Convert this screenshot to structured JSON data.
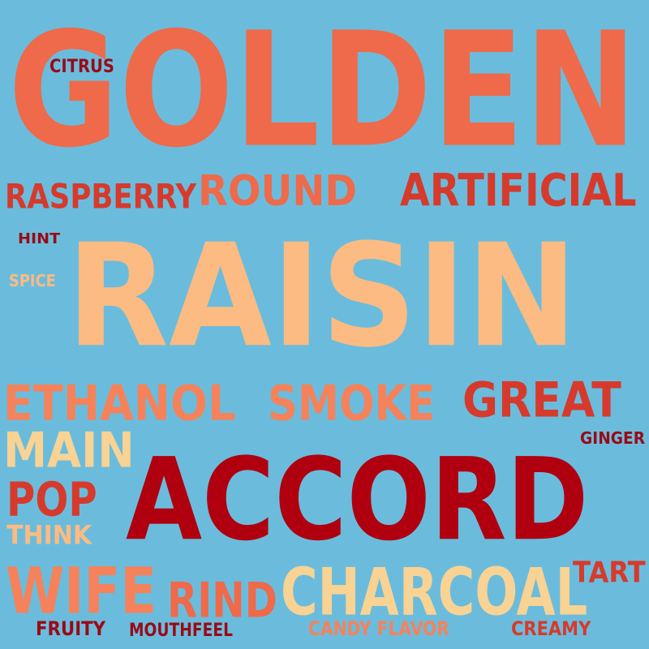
{
  "word_cloud": {
    "background": "#6bbcdc",
    "palette": {
      "salmon": "#ee6a4a",
      "peach": "#fcbb82",
      "red": "#d63a2c",
      "dark_red": "#b00010",
      "maroon": "#9a0a16",
      "light": "#f8d394",
      "orange": "#f5825a"
    },
    "words": {
      "golden": "GOLDEN",
      "citrus": "CITRUS",
      "raspberry": "RASPBERRY",
      "round": "ROUND",
      "artificial": "ARTIFICIAL",
      "hint": "HINT",
      "spice": "SPICE",
      "raisin": "RAISIN",
      "ethanol": "ETHANOL",
      "smoke": "SMOKE",
      "great": "GREAT",
      "main": "MAIN",
      "ginger": "GINGER",
      "pop": "POP",
      "accord": "ACCORD",
      "think": "THINK",
      "wife": "WIFE",
      "rind": "RIND",
      "charcoal": "CHARCOAL",
      "tart": "TART",
      "fruity": "FRUITY",
      "mouthfeel": "MOUTHFEEL",
      "candy_flavor": "CANDY FLAVOR",
      "creamy": "CREAMY"
    }
  }
}
